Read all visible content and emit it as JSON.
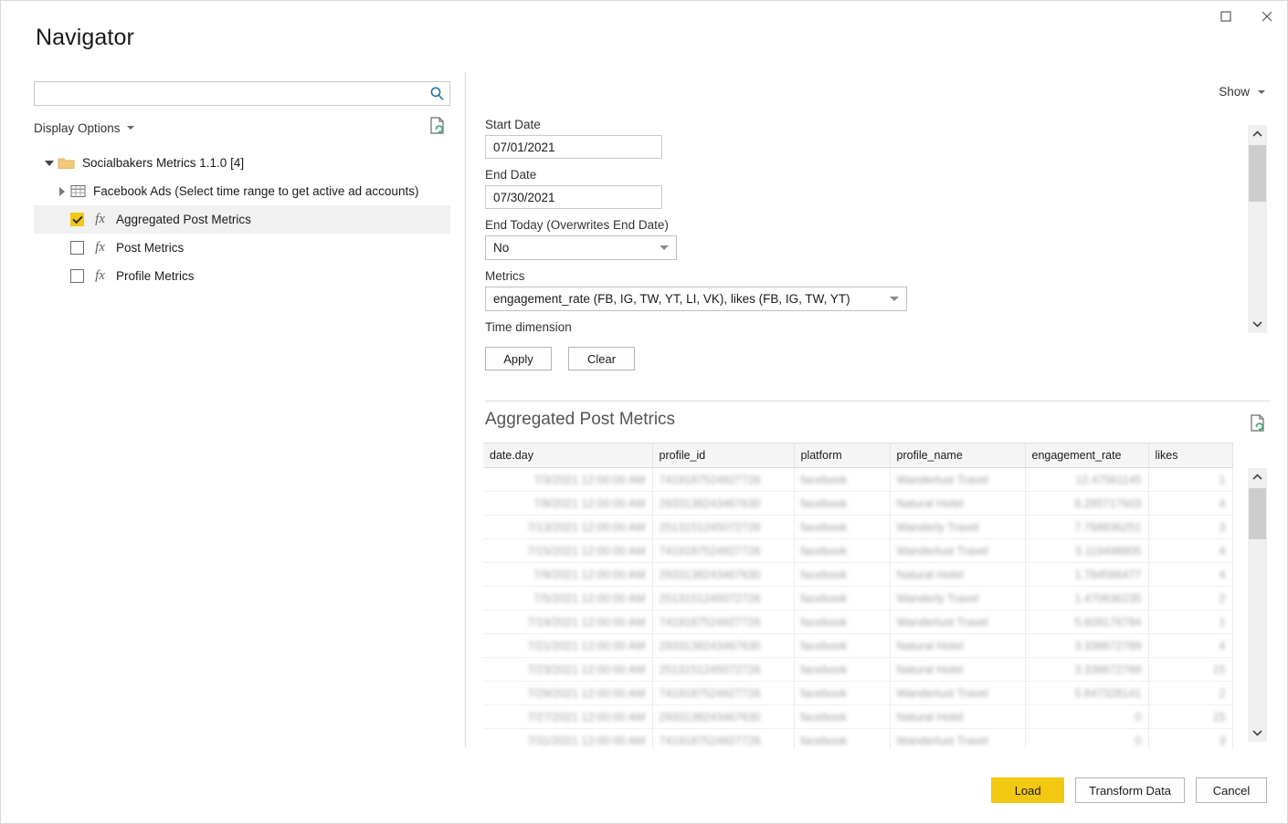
{
  "window": {
    "title": "Navigator",
    "maximize_icon": "maximize-icon",
    "close_icon": "close-icon"
  },
  "left": {
    "search": {
      "value": "",
      "placeholder": "",
      "icon": "search-icon"
    },
    "display_options_label": "Display Options",
    "refresh_icon": "refresh-document-icon",
    "tree": [
      {
        "label": "Socialbakers Metrics 1.1.0 [4]",
        "level": 1,
        "icon": "folder-icon",
        "expander": "expanded",
        "checkbox": "none",
        "selected": false
      },
      {
        "label": "Facebook Ads (Select time range to get active ad accounts)",
        "level": 2,
        "icon": "table-icon",
        "expander": "collapsed",
        "checkbox": "none",
        "selected": false
      },
      {
        "label": "Aggregated Post Metrics",
        "level": 3,
        "icon": "function-icon",
        "expander": "none",
        "checkbox": "checked",
        "selected": true
      },
      {
        "label": "Post Metrics",
        "level": 3,
        "icon": "function-icon",
        "expander": "none",
        "checkbox": "unchecked",
        "selected": false
      },
      {
        "label": "Profile Metrics",
        "level": 3,
        "icon": "function-icon",
        "expander": "none",
        "checkbox": "unchecked",
        "selected": false
      }
    ]
  },
  "right": {
    "show_label": "Show",
    "parameters": {
      "start_date": {
        "label": "Start Date",
        "value": "07/01/2021"
      },
      "end_date": {
        "label": "End Date",
        "value": "07/30/2021"
      },
      "end_today": {
        "label": "End Today (Overwrites End Date)",
        "value": "No"
      },
      "metrics": {
        "label": "Metrics",
        "value": "engagement_rate (FB, IG, TW, YT, LI, VK), likes (FB, IG, TW, YT)"
      },
      "time_dimension": {
        "label": "Time dimension",
        "value": ""
      },
      "apply_label": "Apply",
      "clear_label": "Clear"
    },
    "preview": {
      "title": "Aggregated Post Metrics",
      "refresh_icon": "refresh-document-icon",
      "columns": [
        "date.day",
        "profile_id",
        "platform",
        "profile_name",
        "engagement_rate",
        "likes"
      ],
      "rows": [
        [
          "7/3/2021 12:00:00 AM",
          "7419187524927726",
          "facebook",
          "Wanderlust Travel",
          "12.47561145",
          "1"
        ],
        [
          "7/8/2021 12:00:00 AM",
          "2933138243467630",
          "facebook",
          "Natural Hotel",
          "6.285717603",
          "4"
        ],
        [
          "7/13/2021 12:00:00 AM",
          "2513151245072726",
          "facebook",
          "Wanderly Travel",
          "7.768836251",
          "3"
        ],
        [
          "7/15/2021 12:00:00 AM",
          "7419187524927726",
          "facebook",
          "Wanderlust Travel",
          "5.119498805",
          "4"
        ],
        [
          "7/9/2021 12:00:00 AM",
          "2933138243467630",
          "facebook",
          "Natural Hotel",
          "1.784566477",
          "4"
        ],
        [
          "7/5/2021 12:00:00 AM",
          "2513151245072726",
          "facebook",
          "Wanderly Travel",
          "1.470636235",
          "2"
        ],
        [
          "7/19/2021 12:00:00 AM",
          "7419187524927726",
          "facebook",
          "Wanderlust Travel",
          "5.609176784",
          "1"
        ],
        [
          "7/21/2021 12:00:00 AM",
          "2933138243467630",
          "facebook",
          "Natural Hotel",
          "3.338672789",
          "4"
        ],
        [
          "7/23/2021 12:00:00 AM",
          "2513151245072726",
          "facebook",
          "Natural Hotel",
          "3.338672769",
          "15"
        ],
        [
          "7/29/2021 12:00:00 AM",
          "7419187524927726",
          "facebook",
          "Wanderlust Travel",
          "5.847328141",
          "2"
        ],
        [
          "7/27/2021 12:00:00 AM",
          "2933138243467630",
          "facebook",
          "Natural Hotel",
          "0",
          "15"
        ],
        [
          "7/31/2021 12:00:00 AM",
          "7419187524927726",
          "facebook",
          "Wanderlust Travel",
          "0",
          "3"
        ]
      ]
    }
  },
  "footer": {
    "load_label": "Load",
    "transform_label": "Transform Data",
    "cancel_label": "Cancel"
  },
  "colors": {
    "accent_yellow": "#f2c811",
    "search_blue": "#1d6fa5",
    "folder_tan": "#f3c97b",
    "refresh_green": "#4ea47a"
  }
}
